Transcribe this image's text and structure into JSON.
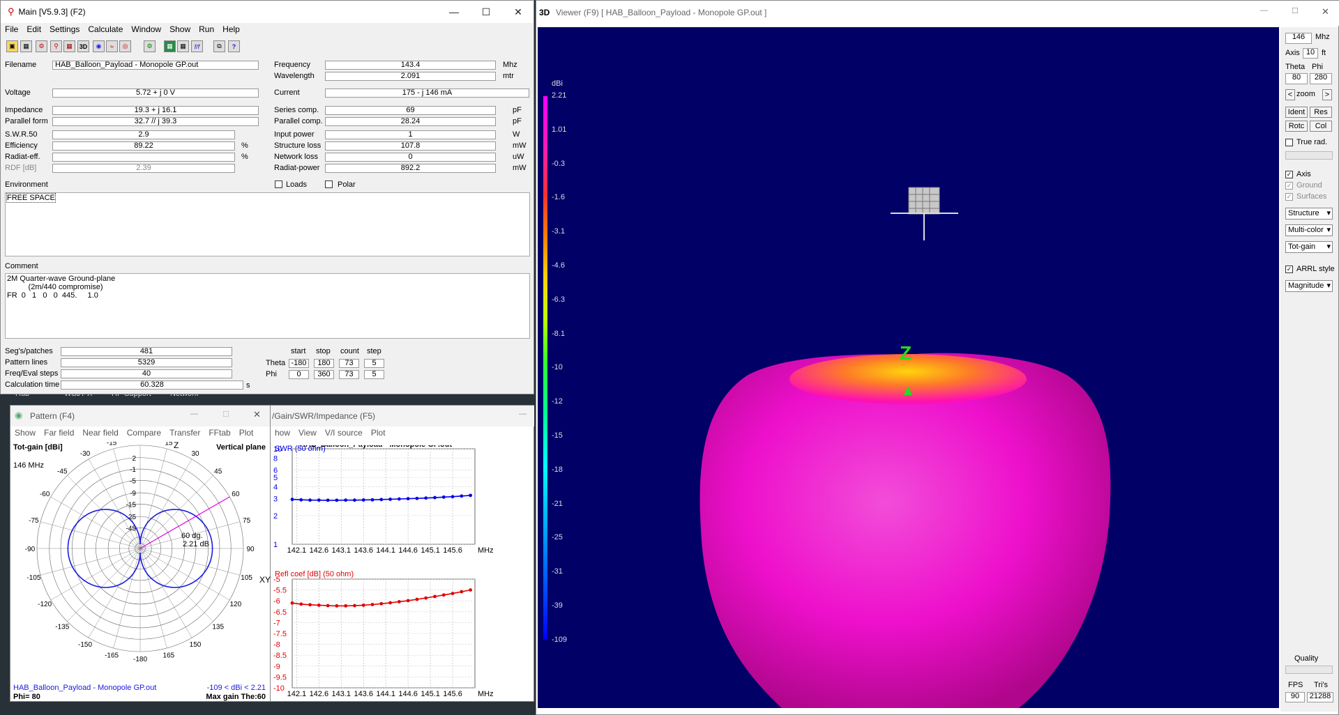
{
  "desktop": {
    "bg_labels": [
      "Hub",
      "WSJT-X",
      "HP Support",
      "Network"
    ]
  },
  "main": {
    "title": "Main [V5.9.3]  (F2)",
    "menu": [
      "File",
      "Edit",
      "Settings",
      "Calculate",
      "Window",
      "Show",
      "Run",
      "Help"
    ],
    "toolbar": [
      "open-icon",
      "save-icon",
      "geometry-icon",
      "antenna-icon",
      "3d-label-icon",
      "chart-icon",
      "grid-icon",
      "spiral-icon",
      "pattern-icon",
      "target-icon",
      "calculator-icon",
      "table-icon",
      "ff-icon",
      "copy-icon",
      "help-icon"
    ],
    "toolbar_3d": "3D",
    "toolbar_ff": "f/f",
    "toolbar_help": "?",
    "filename_label": "Filename",
    "filename": "HAB_Balloon_Payload - Monopole GP.out",
    "frequency_label": "Frequency",
    "frequency": "143.4",
    "frequency_unit": "Mhz",
    "wavelength_label": "Wavelength",
    "wavelength": "2.091",
    "wavelength_unit": "mtr",
    "voltage_label": "Voltage",
    "voltage": "5.72 + j 0 V",
    "current_label": "Current",
    "current": "175 - j 146 mA",
    "impedance_label": "Impedance",
    "impedance": "19.3 + j 16.1",
    "series_label": "Series comp.",
    "series": "69",
    "series_unit": "pF",
    "parallel_form_label": "Parallel form",
    "parallel_form": "32.7 // j 39.3",
    "parallel_comp_label": "Parallel comp.",
    "parallel_comp": "28.24",
    "parallel_comp_unit": "pF",
    "swr_label": "S.W.R.50",
    "swr": "2.9",
    "input_power_label": "Input power",
    "input_power": "1",
    "input_power_unit": "W",
    "efficiency_label": "Efficiency",
    "efficiency": "89.22",
    "efficiency_unit": "%",
    "structure_loss_label": "Structure loss",
    "structure_loss": "107.8",
    "structure_loss_unit": "mW",
    "radiat_eff_label": "Radiat-eff.",
    "radiat_eff": "",
    "radiat_eff_unit": "%",
    "network_loss_label": "Network loss",
    "network_loss": "0",
    "network_loss_unit": "uW",
    "rdf_label": "RDF [dB]",
    "rdf": "2.39",
    "radiat_power_label": "Radiat-power",
    "radiat_power": "892.2",
    "radiat_power_unit": "mW",
    "environment_label": "Environment",
    "loads_label": "Loads",
    "polar_label": "Polar",
    "environment": "FREE SPACE",
    "comment_label": "Comment",
    "comment": "2M Quarter-wave Ground-plane\n          (2m/440 compromise)\nFR  0   1   0   0  445.     1.0",
    "segs_label": "Seg's/patches",
    "segs": "481",
    "pattern_lines_label": "Pattern lines",
    "pattern_lines": "5329",
    "freq_eval_label": "Freq/Eval steps",
    "freq_eval": "40",
    "calc_time_label": "Calculation time",
    "calc_time": "60.328",
    "calc_time_unit": "s",
    "sweep_headers": [
      "start",
      "stop",
      "count",
      "step"
    ],
    "theta_label": "Theta",
    "theta": [
      "-180",
      "180",
      "73",
      "5"
    ],
    "phi_label": "Phi",
    "phi": [
      "0",
      "360",
      "73",
      "5"
    ]
  },
  "pattern": {
    "title": "Pattern   (F4)",
    "menu": [
      "Show",
      "Far field",
      "Near field",
      "Compare",
      "Transfer",
      "FFtab",
      "Plot"
    ],
    "tot_gain": "Tot-gain [dBi]",
    "plane": "Vertical plane",
    "freq": "146 MHz",
    "axis_z": "Z",
    "axis_xy": "XY",
    "marker_angle": "60 dg.",
    "marker_gain": "2.21 dB",
    "filename": "HAB_Balloon_Payload - Monopole GP.out",
    "range": "-109 < dBi < 2.21",
    "phi": "Phi= 80",
    "max_gain": "Max gain The:60",
    "angle_labels": [
      "0",
      "15",
      "30",
      "45",
      "60",
      "75",
      "90",
      "105",
      "120",
      "135",
      "150",
      "165",
      "-180",
      "-165",
      "-150",
      "-135",
      "-120",
      "-105",
      "-90",
      "-75",
      "-60",
      "-45",
      "-30",
      "-15"
    ],
    "ring_labels": [
      "2",
      "-1",
      "-5",
      "-9",
      "-15",
      "-25",
      "-45"
    ],
    "colors": {
      "trace": "#1a1ae0",
      "marker": "#e000e0"
    }
  },
  "swr_window": {
    "title": "/Gain/SWR/Impedance (F5)",
    "menu": [
      "how",
      "View",
      "V/I source",
      "Plot"
    ],
    "file": "HAB_Balloon_Payload - Monopole GP.out",
    "swr_label": "SWR (50 ohm)",
    "refl_label": "Refl coef [dB] (50 ohm)",
    "x_ticks": [
      "142.1",
      "142.6",
      "143.1",
      "143.6",
      "144.1",
      "144.6",
      "145.1",
      "145.6"
    ],
    "x_unit": "MHz"
  },
  "chart_data": [
    {
      "type": "line",
      "title": "SWR (50 ohm)",
      "xlabel": "MHz",
      "ylabel": "SWR",
      "yticks": [
        "10",
        "8",
        "6",
        "5",
        "4",
        "3",
        "2",
        "1"
      ],
      "ylim": [
        1,
        10
      ],
      "yscale": "log",
      "x": [
        142.0,
        142.2,
        142.4,
        142.6,
        142.8,
        143.0,
        143.2,
        143.4,
        143.6,
        143.8,
        144.0,
        144.2,
        144.4,
        144.6,
        144.8,
        145.0,
        145.2,
        145.4,
        145.6,
        145.8,
        146.0
      ],
      "series": [
        {
          "name": "SWR",
          "color": "#0000e6",
          "values": [
            2.95,
            2.92,
            2.9,
            2.9,
            2.89,
            2.89,
            2.9,
            2.9,
            2.91,
            2.92,
            2.94,
            2.96,
            2.98,
            3.0,
            3.02,
            3.05,
            3.08,
            3.12,
            3.15,
            3.2,
            3.25
          ]
        }
      ]
    },
    {
      "type": "line",
      "title": "Refl coef [dB] (50 ohm)",
      "xlabel": "MHz",
      "ylabel": "dB",
      "yticks": [
        "-5",
        "-5.5",
        "-6",
        "-6.5",
        "-7",
        "-7.5",
        "-8",
        "-8.5",
        "-9",
        "-9.5",
        "-10"
      ],
      "ylim": [
        -10,
        -5
      ],
      "x": [
        142.0,
        142.2,
        142.4,
        142.6,
        142.8,
        143.0,
        143.2,
        143.4,
        143.6,
        143.8,
        144.0,
        144.2,
        144.4,
        144.6,
        144.8,
        145.0,
        145.2,
        145.4,
        145.6,
        145.8,
        146.0
      ],
      "series": [
        {
          "name": "Refl coef",
          "color": "#e00000",
          "values": [
            -6.1,
            -6.15,
            -6.18,
            -6.2,
            -6.22,
            -6.23,
            -6.23,
            -6.22,
            -6.2,
            -6.17,
            -6.13,
            -6.09,
            -6.04,
            -5.99,
            -5.93,
            -5.87,
            -5.8,
            -5.73,
            -5.66,
            -5.58,
            -5.5
          ]
        }
      ]
    }
  ],
  "viewer": {
    "title_3d": "3D",
    "title": "Viewer (F9)    [ HAB_Balloon_Payload - Monopole GP.out ]",
    "dbi_label": "dBi",
    "scale": [
      "2.21",
      "1.01",
      "-0.3",
      "-1.6",
      "-3.1",
      "-4.6",
      "-6.3",
      "-8.1",
      "-10",
      "-12",
      "-15",
      "-18",
      "-21",
      "-25",
      "-31",
      "-39",
      "-109"
    ],
    "z_label": "Z",
    "bg_color": "#000066"
  },
  "sidepanel": {
    "freq": "146",
    "freq_unit": "Mhz",
    "axis_label": "Axis",
    "axis": "10",
    "axis_unit": "ft",
    "theta_label": "Theta",
    "phi_label": "Phi",
    "theta": "80",
    "phi": "280",
    "zoom_prev": "<",
    "zoom_label": "zoom",
    "zoom_next": ">",
    "ident": "Ident",
    "res": "Res",
    "rotc": "Rotc",
    "col": "Col",
    "true_rad": "True rad.",
    "axis_chk": "Axis",
    "ground_chk": "Ground",
    "surfaces_chk": "Surfaces",
    "sel_structure": "Structure",
    "sel_color": "Multi-color",
    "sel_gain": "Tot-gain",
    "arrl": "ARRL style",
    "sel_mag": "Magnitude",
    "quality": "Quality",
    "fps_label": "FPS",
    "tris_label": "Tri's",
    "fps": "90",
    "tris": "21288"
  }
}
